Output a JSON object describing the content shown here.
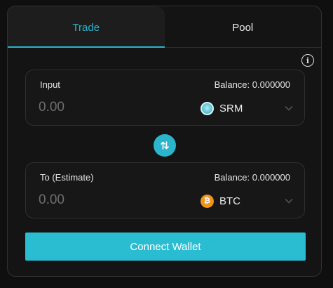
{
  "tabs": [
    {
      "label": "Trade",
      "active": true
    },
    {
      "label": "Pool",
      "active": false
    }
  ],
  "info_icon": "info-circle-icon",
  "input_box": {
    "label": "Input",
    "balance": "Balance: 0.000000",
    "amount_placeholder": "0.00",
    "token": {
      "symbol": "SRM",
      "icon": "srm-coin-icon"
    }
  },
  "swap_icon": "swap-arrows-icon",
  "output_box": {
    "label": "To (Estimate)",
    "balance": "Balance: 0.000000",
    "amount_placeholder": "0.00",
    "token": {
      "symbol": "BTC",
      "icon": "btc-coin-icon"
    }
  },
  "connect_button": {
    "label": "Connect Wallet"
  },
  "colors": {
    "accent": "#2ab5cc",
    "button": "#2abdd2",
    "btc": "#f2931a",
    "card_bg": "#141414"
  }
}
